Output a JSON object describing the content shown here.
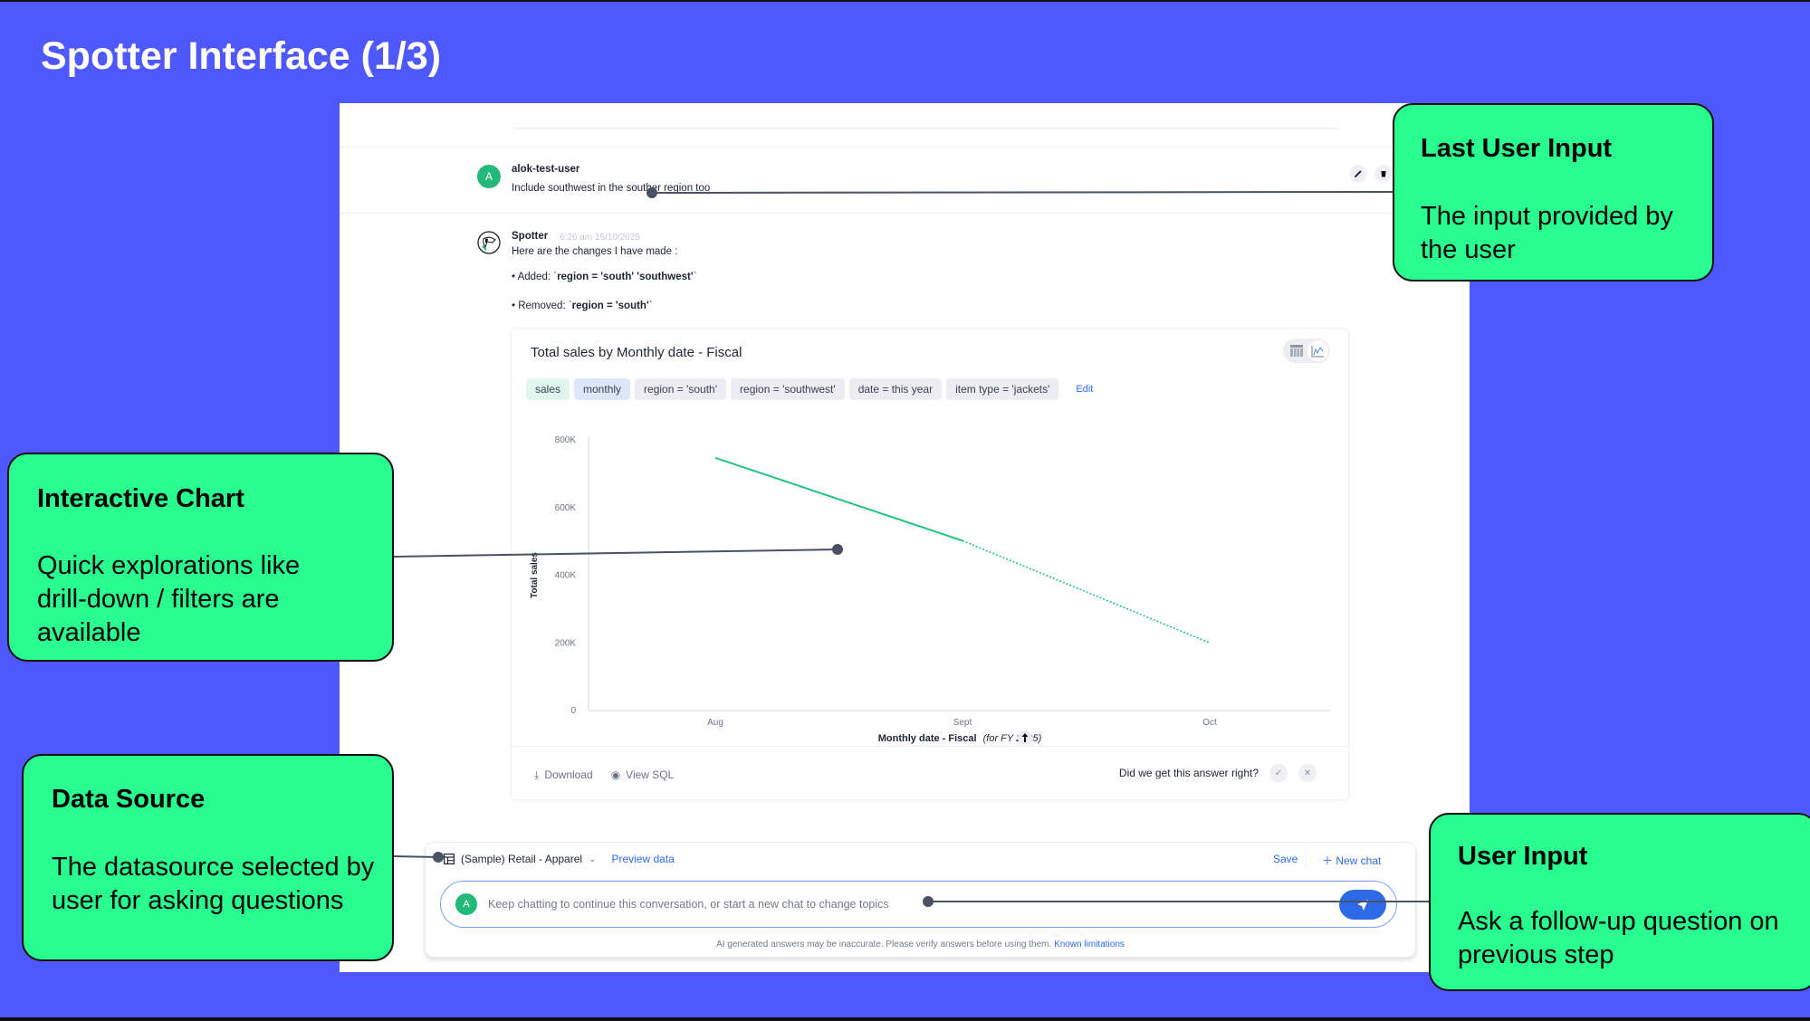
{
  "slide": {
    "title": "Spotter Interface (1/3)"
  },
  "conversation": {
    "user_message": {
      "avatar_initial": "A",
      "username": "alok-test-user",
      "text": "Include southwest in the souther region too",
      "actions": [
        {
          "icon": "pencil-icon",
          "glyph": "✎",
          "label": "Edit"
        },
        {
          "icon": "trash-icon",
          "glyph": "🗑",
          "label": "Delete"
        }
      ]
    },
    "spotter_message": {
      "name": "Spotter",
      "timestamp": "6:26 am 15/10/2025",
      "intro": "Here are the changes I have made :",
      "changes": [
        {
          "prefix": "• Added: `",
          "code": "region = 'south' 'southwest'",
          "suffix": "`"
        },
        {
          "prefix": "• Removed: `",
          "code": "region = 'south'",
          "suffix": "`"
        }
      ]
    }
  },
  "answer": {
    "title": "Total sales by Monthly date - Fiscal",
    "view_toggle": [
      "table-view",
      "chart-view"
    ],
    "active_view": "chart-view",
    "chips": [
      {
        "label": "sales",
        "kind": "measure"
      },
      {
        "label": "monthly",
        "kind": "attribute"
      },
      {
        "label": "region = 'south'",
        "kind": "filter"
      },
      {
        "label": "region = 'southwest'",
        "kind": "filter"
      },
      {
        "label": "date = this year",
        "kind": "filter"
      },
      {
        "label": "item type = 'jackets'",
        "kind": "filter"
      }
    ],
    "edit_label": "Edit",
    "footer": {
      "download_label": "Download",
      "view_sql_label": "View SQL",
      "feedback_question": "Did we get this answer right?",
      "thumbs_up_glyph": "✓",
      "thumbs_down_glyph": "✕"
    }
  },
  "chart_data": {
    "type": "line",
    "title": "Total sales by Monthly date - Fiscal",
    "xlabel": "Monthly date - Fiscal",
    "xlabel_suffix": "(for FY 2025)",
    "ylabel": "Total sales",
    "categories": [
      "Aug",
      "Sept",
      "Oct"
    ],
    "series": [
      {
        "name": "Total sales",
        "values": [
          747000,
          502000,
          200000
        ],
        "color": "#27c386",
        "projected_from_index": 1
      }
    ],
    "yticks": [
      0,
      200000,
      400000,
      600000,
      800000
    ],
    "ytick_labels": [
      "0",
      "200K",
      "400K",
      "600K",
      "800K"
    ],
    "ylim": [
      0,
      800000
    ],
    "grid": false,
    "legend": "none"
  },
  "input_area": {
    "datasource": "(Sample) Retail - Apparel",
    "preview_label": "Preview data",
    "save_label": "Save",
    "new_chat_label": "New chat",
    "avatar_initial": "A",
    "placeholder": "Keep chatting to continue this conversation, or start a new chat to change topics",
    "value": "",
    "disclaimer": "AI generated answers may be inaccurate. Please verify answers before using them.",
    "disclaimer_link": "Known limitations"
  },
  "callouts": [
    {
      "id": "last-user-input",
      "title": "Last User Input",
      "body": "The input provided by the user"
    },
    {
      "id": "interactive-chart",
      "title": "Interactive Chart",
      "body": "Quick explorations like drill-down / filters are available"
    },
    {
      "id": "data-source",
      "title": "Data Source",
      "body": "The datasource selected by user for asking questions"
    },
    {
      "id": "user-input",
      "title": "User Input",
      "body": "Ask a follow-up question on previous step"
    }
  ],
  "colors": {
    "background": "#4f58fd",
    "callout": "#2afd8f",
    "accent": "#2d6ae8",
    "avatar": "#23b97a",
    "series": "#27c386",
    "connector": "#4a5165"
  }
}
